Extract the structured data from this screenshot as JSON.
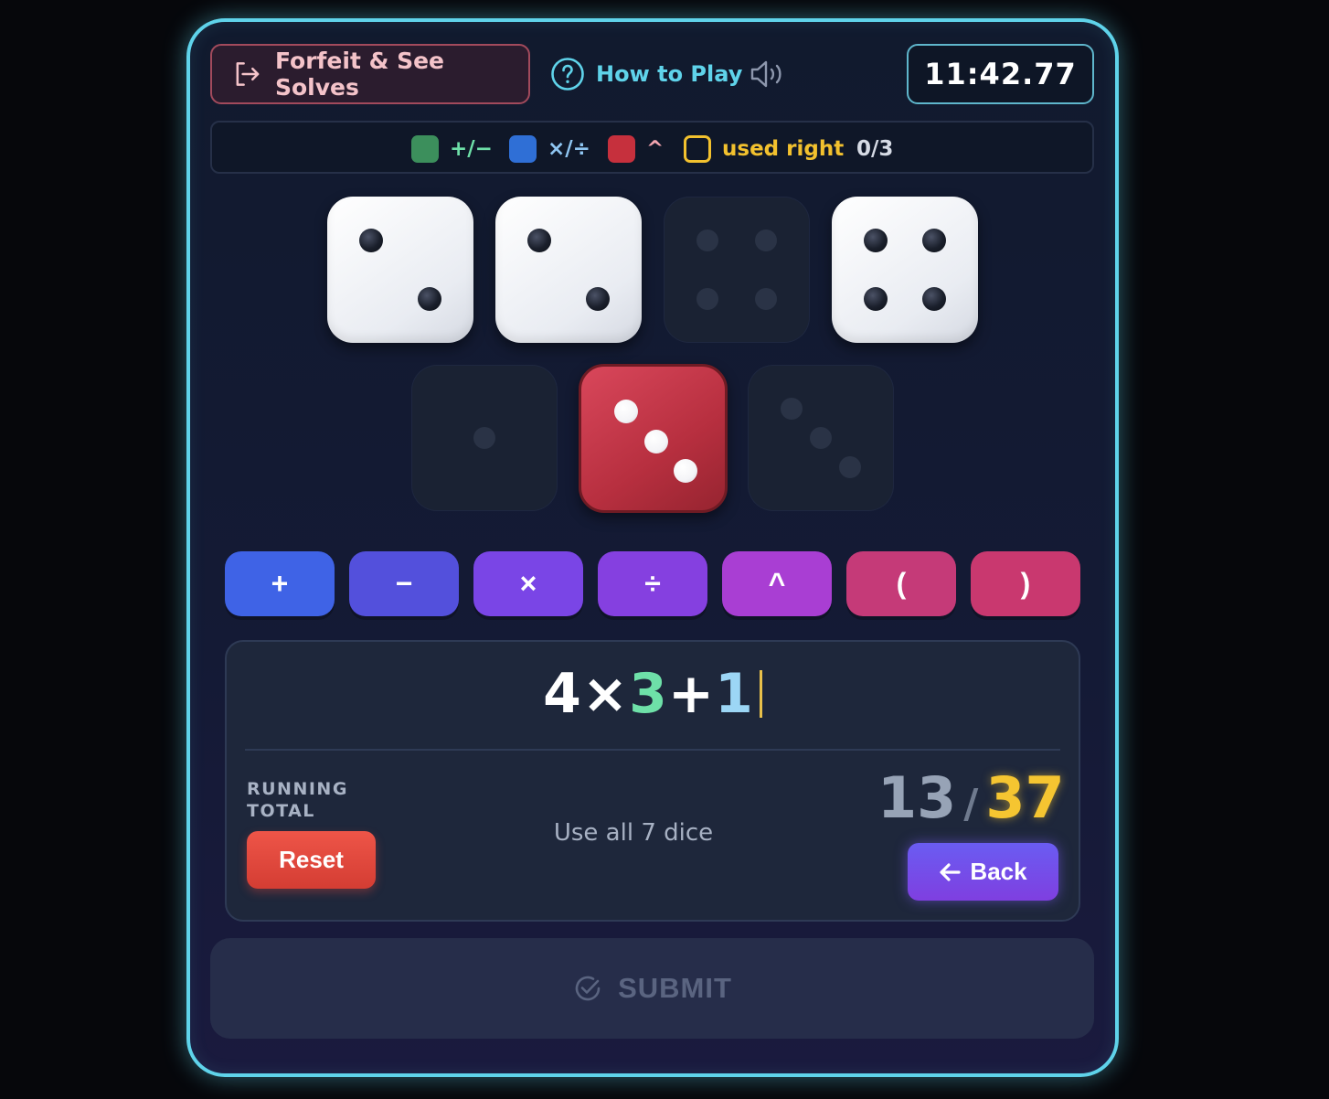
{
  "header": {
    "forfeit_label": "Forfeit & See Solves",
    "help_label": "How to Play",
    "timer": "11:42.77"
  },
  "legend": {
    "items": [
      {
        "label": "+/−",
        "color": "#3c8f5c",
        "text_color": "#6ee0a8"
      },
      {
        "label": "×/÷",
        "color": "#2f6fd6",
        "text_color": "#8fc6f2"
      },
      {
        "label": "^",
        "color": "#c6303d",
        "text_color": "#f3a5b0"
      }
    ],
    "used_right_label": "used right",
    "used_right_color": "#f2c12e",
    "progress": "0/3"
  },
  "dice": [
    {
      "value": 2,
      "state": "available"
    },
    {
      "value": 2,
      "state": "available"
    },
    {
      "value": 4,
      "state": "used"
    },
    {
      "value": 4,
      "state": "available"
    },
    {
      "value": 1,
      "state": "used"
    },
    {
      "value": 3,
      "state": "available",
      "color": "red"
    },
    {
      "value": 3,
      "state": "used"
    }
  ],
  "operators": [
    {
      "label": "+",
      "color": "#3f63e6"
    },
    {
      "label": "−",
      "color": "#5350dc"
    },
    {
      "label": "×",
      "color": "#7a45e6"
    },
    {
      "label": "÷",
      "color": "#8540e0"
    },
    {
      "label": "^",
      "color": "#a93ed3"
    },
    {
      "label": "(",
      "color": "#c53a78"
    },
    {
      "label": ")",
      "color": "#c9386f"
    }
  ],
  "expression": {
    "tokens": [
      {
        "text": "4",
        "style": "white"
      },
      {
        "text": "×",
        "style": "white"
      },
      {
        "text": "3",
        "style": "green"
      },
      {
        "text": "+",
        "style": "white"
      },
      {
        "text": "1",
        "style": "blue"
      }
    ]
  },
  "panel": {
    "running_total_label": "RUNNING TOTAL",
    "reset_label": "Reset",
    "hint": "Use all 7 dice",
    "current_total": "13",
    "separator": "/",
    "target": "37",
    "back_label": "Back"
  },
  "submit_label": "SUBMIT"
}
